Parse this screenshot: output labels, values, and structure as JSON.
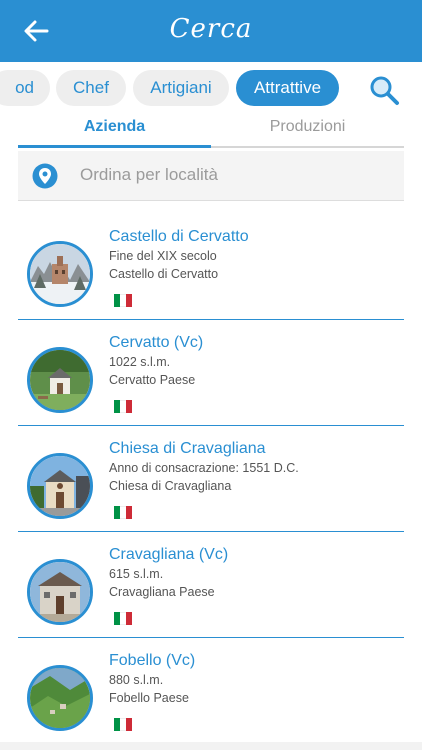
{
  "header": {
    "title": "Cerca",
    "back_icon": "arrow-left-icon"
  },
  "chips": [
    {
      "label": "od",
      "active": false
    },
    {
      "label": "Chef",
      "active": false
    },
    {
      "label": "Artigiani",
      "active": false
    },
    {
      "label": "Attrattive",
      "active": true
    }
  ],
  "search_icon": "magnifier-icon",
  "tabs": [
    {
      "label": "Azienda",
      "active": true
    },
    {
      "label": "Produzioni",
      "active": false
    }
  ],
  "sort": {
    "label": "Ordina per località",
    "icon": "location-pin-icon"
  },
  "items": [
    {
      "title": "Castello di Cervatto",
      "line1": "Fine del XIX secolo",
      "line2": "Castello di Cervatto",
      "flag": "italy-flag"
    },
    {
      "title": "Cervatto (Vc)",
      "line1": "1022 s.l.m.",
      "line2": "Cervatto Paese",
      "flag": "italy-flag"
    },
    {
      "title": "Chiesa di Cravagliana",
      "line1": "Anno di consacrazione: 1551 D.C.",
      "line2": "Chiesa di Cravagliana",
      "flag": "italy-flag"
    },
    {
      "title": "Cravagliana (Vc)",
      "line1": "615 s.l.m.",
      "line2": "Cravagliana Paese",
      "flag": "italy-flag"
    },
    {
      "title": "Fobello (Vc)",
      "line1": "880 s.l.m.",
      "line2": "Fobello Paese",
      "flag": "italy-flag"
    }
  ],
  "colors": {
    "primary": "#2a8fd2",
    "chip_bg": "#eeeeee",
    "flag_green": "#009246",
    "flag_white": "#ffffff",
    "flag_red": "#ce2b37"
  }
}
